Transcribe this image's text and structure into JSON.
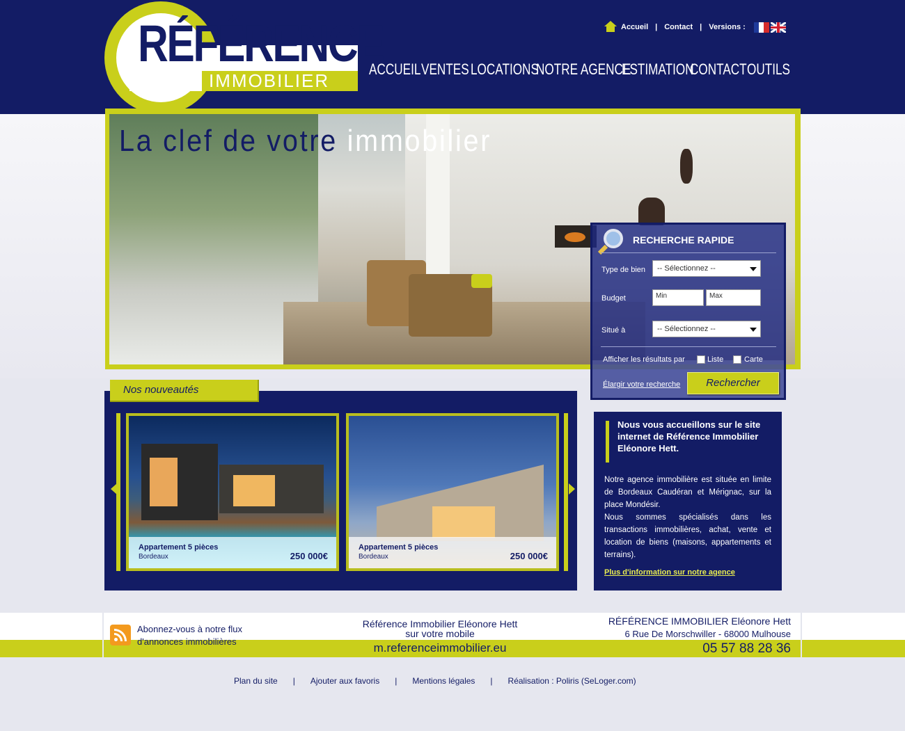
{
  "logo": {
    "line1": "RÉFÉRENCE",
    "line2": "IMMOBILIER"
  },
  "toplinks": {
    "home": "Accueil",
    "contact": "Contact",
    "versions": "Versions :",
    "separator": "|",
    "icons": {
      "home": "house-icon",
      "fr": "flag-fr-icon",
      "en": "flag-uk-icon"
    }
  },
  "nav": [
    "ACCUEIL",
    "VENTES",
    "LOCATIONS",
    "NOTRE AGENCE",
    "ESTIMATION",
    "CONTACT",
    "OUTILS"
  ],
  "hero": {
    "slogan_part1": "La clef de votre",
    "slogan_part2": " immobilier"
  },
  "search": {
    "title": "RECHERCHE RAPIDE",
    "type_label": "Type de bien",
    "type_value": "-- Sélectionnez --",
    "budget_label": "Budget",
    "budget_min_placeholder": "Min",
    "budget_max_placeholder": "Max",
    "location_label": "Situé à",
    "location_value": "-- Sélectionnez --",
    "display_label": "Afficher les résultats par",
    "option_list": "Liste",
    "option_map": "Carte",
    "widen_link": "Élargir votre recherche",
    "submit": "Rechercher"
  },
  "news": {
    "tab": "Nos nouveautés",
    "items": [
      {
        "title": "Appartement 5 pièces",
        "city": "Bordeaux",
        "price": "250 000€"
      },
      {
        "title": "Appartement 5 pièces",
        "city": "Bordeaux",
        "price": "250 000€"
      }
    ]
  },
  "welcome": {
    "heading": "Nous vous accueillons sur le site internet de Référence Immobilier Eléonore Hett.",
    "body1": "Notre agence immobilière est située en limite de Bordeaux Caudéran et Mérignac, sur la place Mondésir.",
    "body2": "Nous sommes spécialisés dans les transactions immobilières, achat, vente et location de biens (maisons, appartements et terrains).",
    "more": "Plus d'information sur notre agence"
  },
  "footer": {
    "rss": "Abonnez-vous à notre flux d'annonces immobilières",
    "mobile_line1": "Référence Immobilier Eléonore Hett",
    "mobile_line2": "sur votre mobile",
    "mobile_url": "m.referenceimmobilier.eu",
    "agency_name": "RÉFÉRENCE IMMOBILIER Eléonore Hett",
    "agency_address": "6 Rue De Morschwiller - 68000 Mulhouse",
    "agency_phone": "05 57 88 28 36"
  },
  "bottomlinks": [
    "Plan du site",
    "Ajouter aux favoris",
    "Mentions légales",
    "Réalisation : Poliris (SeLoger.com)"
  ],
  "colors": {
    "navy": "#131c65",
    "lime": "#c9cf1b",
    "background": "#e6e7ef"
  }
}
